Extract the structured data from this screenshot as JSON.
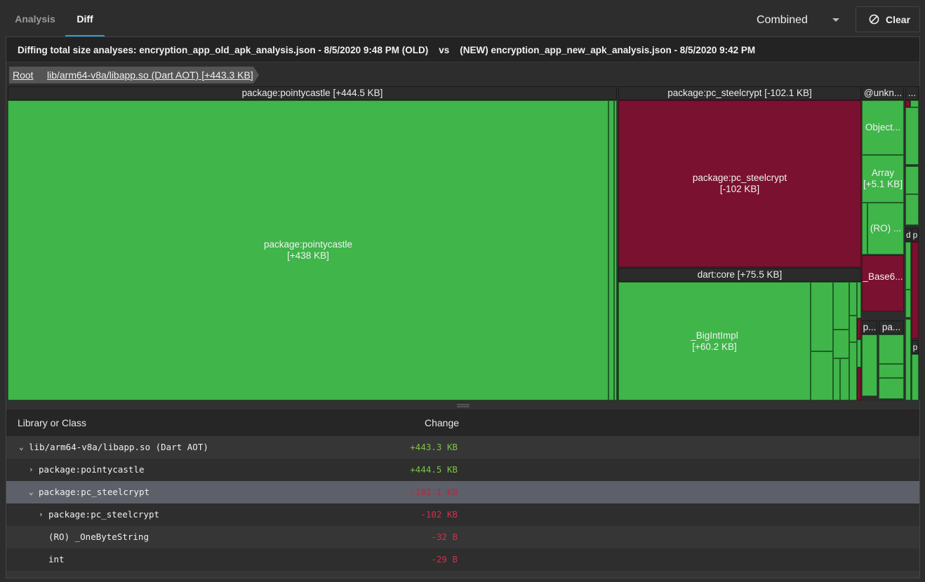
{
  "tabs": [
    {
      "label": "Analysis",
      "active": false
    },
    {
      "label": "Diff",
      "active": true
    }
  ],
  "toolbar": {
    "mode_value": "Combined",
    "clear_label": "Clear"
  },
  "diff_title": "Diffing total size analyses: encryption_app_old_apk_analysis.json - 8/5/2020 9:48 PM (OLD)    vs    (NEW) encryption_app_new_apk_analysis.json - 8/5/2020 9:42 PM",
  "breadcrumbs": [
    {
      "label": "Root"
    },
    {
      "label": "lib/arm64-v8a/libapp.so (Dart AOT) [+443.3 KB]"
    }
  ],
  "treemap": {
    "colors": {
      "increase": "#3fb54a",
      "decrease": "#7a1130",
      "header": "#2b2b2b"
    },
    "groups": {
      "pointycastle": {
        "header": "package:pointycastle [+444.5 KB]",
        "main_cell": "package:pointycastle\n[+438 KB]"
      },
      "steelcrypt": {
        "header": "package:pc_steelcrypt [-102.1 KB]",
        "main_cell": "package:pc_steelcrypt\n[-102 KB]"
      },
      "dartcore": {
        "header": "dart:core [+75.5 KB]",
        "main_cell": "_BigIntImpl\n[+60.2 KB]"
      },
      "unknown": {
        "header": "@unkn...",
        "object_cell": "Object...",
        "array_cell": "Array\n[+5.1 KB]",
        "ro_cell": "(RO) ...",
        "base_cell": "_Base6...",
        "small_header_1": "p...",
        "small_header_2": "pa..."
      },
      "misc": {
        "header": "...",
        "d_header": "d",
        "p_header": "p",
        "p_header_2": "p"
      }
    }
  },
  "table": {
    "columns": {
      "name": "Library or Class",
      "change": "Change"
    },
    "rows": [
      {
        "name": "lib/arm64-v8a/libapp.so (Dart AOT)",
        "change": "+443.3 KB",
        "arrow": "⌄",
        "sign": "pos"
      },
      {
        "name": "package:pointycastle",
        "change": "+444.5 KB",
        "arrow": "›",
        "sign": "pos"
      },
      {
        "name": "package:pc_steelcrypt",
        "change": "-102.1 KB",
        "arrow": "⌄",
        "sign": "neg",
        "selected": true
      },
      {
        "name": "package:pc_steelcrypt",
        "change": "-102 KB",
        "arrow": "›",
        "sign": "neg"
      },
      {
        "name": "(RO) _OneByteString",
        "change": "-32 B",
        "arrow": "",
        "sign": "neg"
      },
      {
        "name": "int",
        "change": "-29 B",
        "arrow": "",
        "sign": "neg"
      }
    ]
  }
}
